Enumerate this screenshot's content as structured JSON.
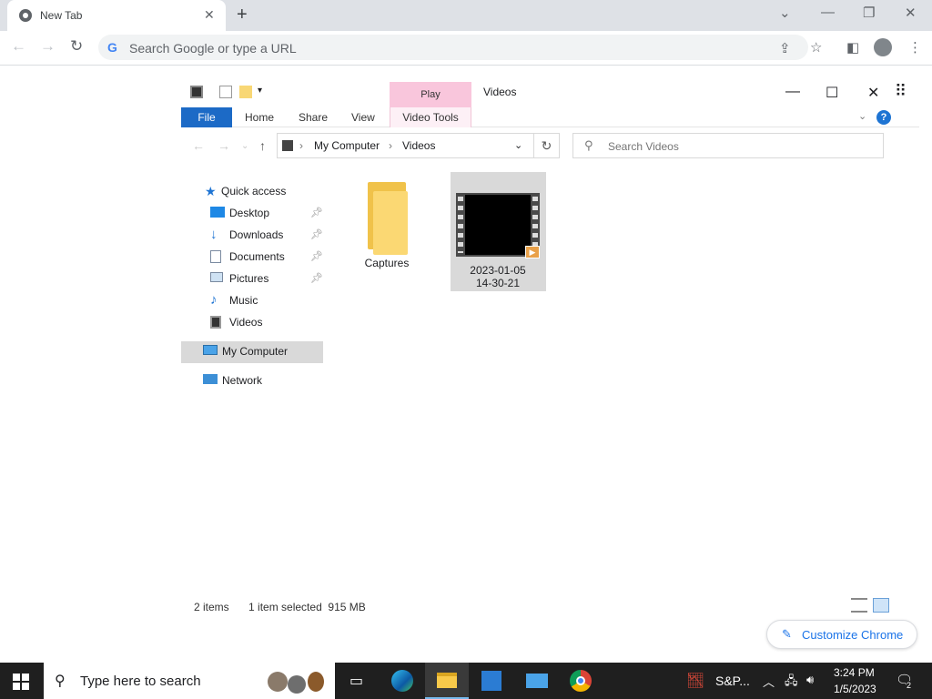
{
  "browser": {
    "tab_title": "New Tab",
    "omnibox_placeholder": "Search Google or type a URL",
    "customize_label": "Customize Chrome"
  },
  "explorer": {
    "window_title": "Videos",
    "contextual_tab": "Play",
    "ribbon": {
      "file": "File",
      "home": "Home",
      "share": "Share",
      "view": "View",
      "video_tools": "Video Tools"
    },
    "address": {
      "crumbs": [
        "My Computer",
        "Videos"
      ]
    },
    "search_placeholder": "Search Videos",
    "nav": {
      "quick_access": "Quick access",
      "items": [
        {
          "label": "Desktop",
          "icon": "desktop-icon",
          "pinned": true
        },
        {
          "label": "Downloads",
          "icon": "downloads-icon",
          "pinned": true
        },
        {
          "label": "Documents",
          "icon": "documents-icon",
          "pinned": true
        },
        {
          "label": "Pictures",
          "icon": "pictures-icon",
          "pinned": true
        },
        {
          "label": "Music",
          "icon": "music-icon",
          "pinned": false
        },
        {
          "label": "Videos",
          "icon": "videos-icon",
          "pinned": false
        }
      ],
      "my_computer": "My Computer",
      "network": "Network"
    },
    "files": [
      {
        "name": "Captures",
        "type": "folder"
      },
      {
        "name_line1": "2023-01-05",
        "name_line2": "14-30-21",
        "type": "video",
        "selected": true
      }
    ],
    "status": {
      "count": "2 items",
      "selection": "1 item selected  915 MB"
    }
  },
  "taskbar": {
    "search_placeholder": "Type here to search",
    "stock": "S&P...",
    "time": "3:24 PM",
    "date": "1/5/2023",
    "notification_count": "2"
  },
  "colors": {
    "accent": "#1c6ac6",
    "play_tab": "#f9c6dc",
    "selection": "#d9d9d9"
  }
}
